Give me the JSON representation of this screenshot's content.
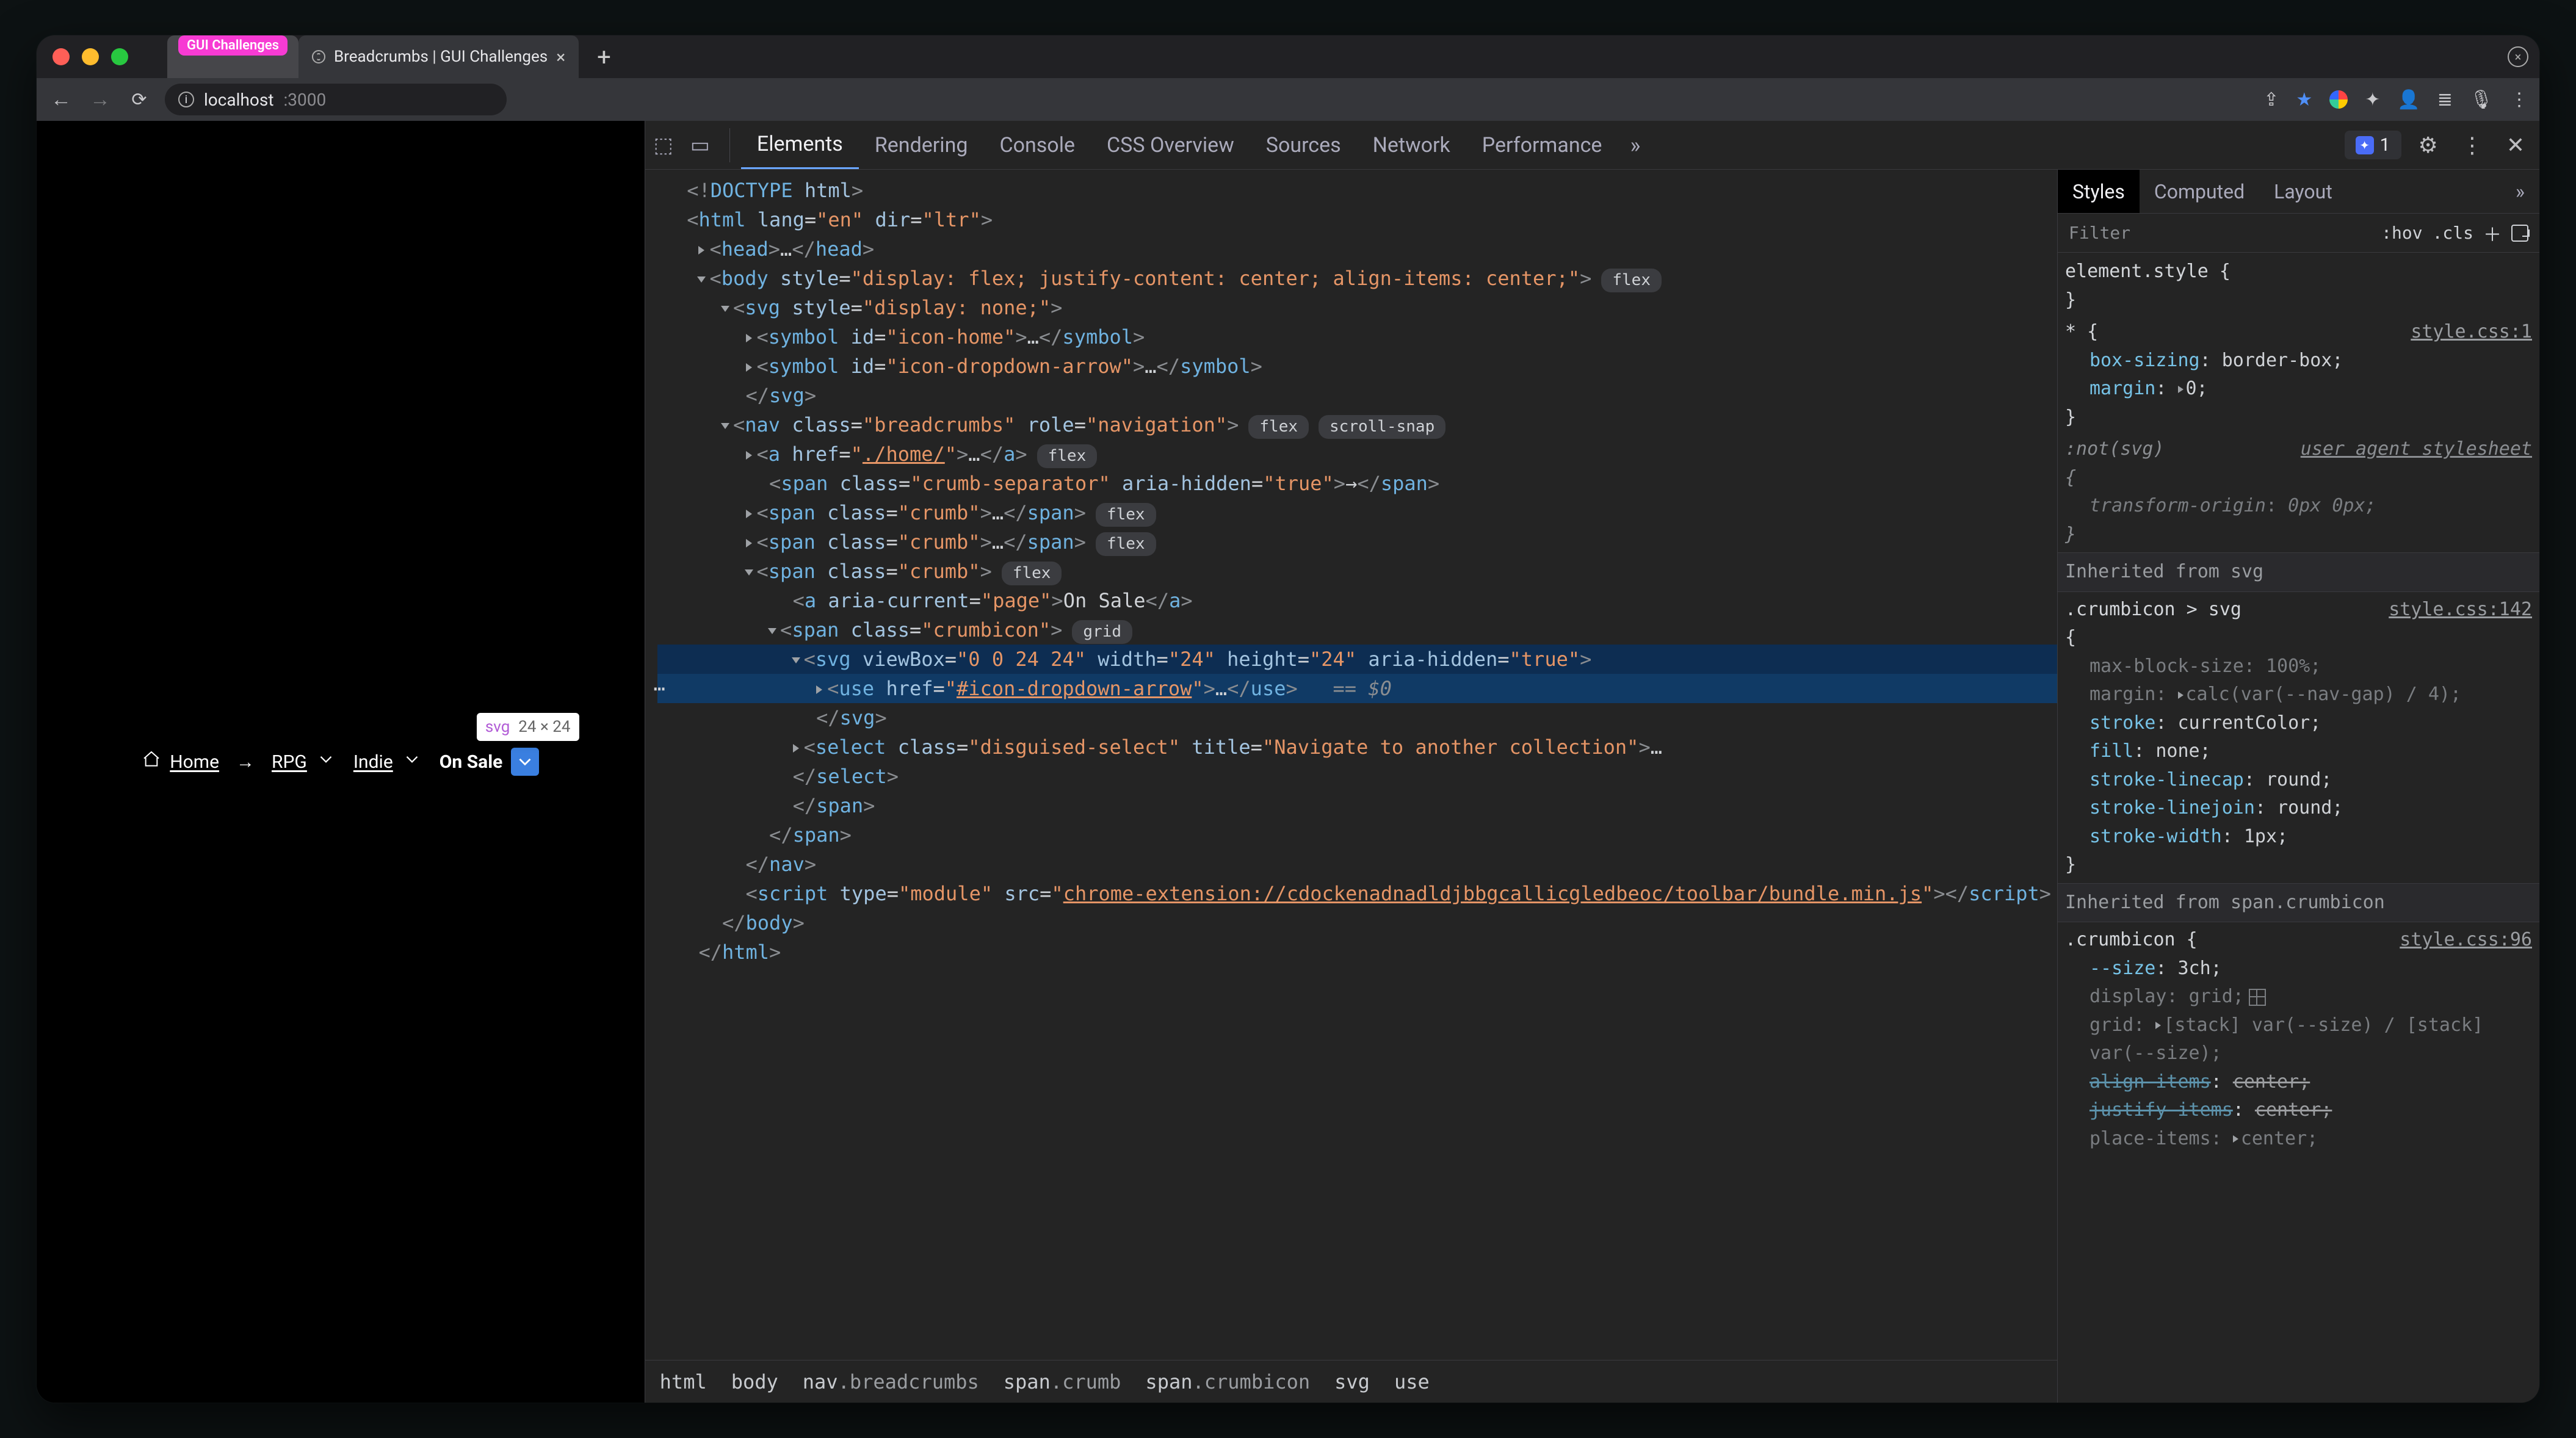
{
  "window": {
    "tabs": [
      {
        "label": "GUI Challenges",
        "kind": "pill"
      },
      {
        "label": "Breadcrumbs | GUI Challenges",
        "kind": "active"
      }
    ]
  },
  "url": {
    "host": "localhost",
    "port": ":3000"
  },
  "page": {
    "tooltip": {
      "tag": "svg",
      "dim": "24 × 24"
    },
    "crumbs": {
      "home": "Home",
      "rpg": "RPG",
      "indie": "Indie",
      "onsale": "On Sale"
    }
  },
  "devtools": {
    "tabs": [
      "Elements",
      "Rendering",
      "Console",
      "CSS Overview",
      "Sources",
      "Network",
      "Performance"
    ],
    "activeTab": "Elements",
    "errorsCount": "1",
    "stylesTabs": [
      "Styles",
      "Computed",
      "Layout"
    ],
    "filterPlaceholder": "Filter",
    "hov": ":hov",
    "cls": ".cls",
    "pathNodes": [
      {
        "el": "html",
        "cls": ""
      },
      {
        "el": "body",
        "cls": ""
      },
      {
        "el": "nav",
        "cls": ".breadcrumbs"
      },
      {
        "el": "span",
        "cls": ".crumb"
      },
      {
        "el": "span",
        "cls": ".crumbicon"
      },
      {
        "el": "svg",
        "cls": ""
      },
      {
        "el": "use",
        "cls": ""
      }
    ],
    "dom": {
      "doctype": "<!DOCTYPE html>",
      "htmlOpen": {
        "attrs": "lang=\"en\" dir=\"ltr\""
      },
      "bodyStyle": "display: flex; justify-content: center; align-items: center;",
      "svgStyle": "display: none;",
      "sym1": "icon-home",
      "sym2": "icon-dropdown-arrow",
      "navClass": "breadcrumbs",
      "navRole": "navigation",
      "aHref": "./home/",
      "sepClass": "crumb-separator",
      "sepAria": "true",
      "crumbClass": "crumb",
      "aCurrent": "page",
      "aText": "On Sale",
      "iconClass": "crumbicon",
      "svgVb": "0 0 24 24",
      "svgW": "24",
      "svgH": "24",
      "svgAria": "true",
      "useHref": "#icon-dropdown-arrow",
      "eqVar": "== $0",
      "selectClass": "disguised-select",
      "selectTitle": "Navigate to another collection",
      "scriptType": "module",
      "scriptSrc": "chrome-extension://cdockenadnadldjbbgcallicgledbeoc/toolbar/bundle.min.js"
    },
    "styles": {
      "r0": {
        "sel": "element.style {"
      },
      "r1": {
        "sel": "* {",
        "src": "style.css:1",
        "p": [
          {
            "k": "box-sizing",
            "v": "border-box;"
          },
          {
            "k": "margin",
            "v": "0;",
            "tri": true
          }
        ]
      },
      "r2": {
        "sel": ":not(svg)",
        "src": "user agent stylesheet",
        "p": [
          {
            "k": "transform-origin",
            "v": "0px 0px;"
          }
        ],
        "italicSrc": true,
        "muted": true
      },
      "inh1": {
        "label": "Inherited from",
        "code": "svg"
      },
      "r3": {
        "sel": ".crumbicon > svg",
        "src": "style.css:142",
        "p": [
          {
            "k": "max-block-size",
            "v": "100%;",
            "muted": true
          },
          {
            "k": "margin",
            "v": "calc(var(--nav-gap) / 4);",
            "tri": true,
            "muted": true
          },
          {
            "k": "stroke",
            "v": "currentColor;"
          },
          {
            "k": "fill",
            "v": "none;"
          },
          {
            "k": "stroke-linecap",
            "v": "round;"
          },
          {
            "k": "stroke-linejoin",
            "v": "round;"
          },
          {
            "k": "stroke-width",
            "v": "1px;"
          }
        ]
      },
      "inh2": {
        "label": "Inherited from",
        "code": "span.crumbicon"
      },
      "r4": {
        "sel": ".crumbicon {",
        "src": "style.css:96",
        "p": [
          {
            "k": "--size",
            "v": "3ch;"
          },
          {
            "k": "display",
            "v": "grid;",
            "muted": true,
            "glyph": true
          },
          {
            "k": "grid",
            "v": "[stack] var(--size) / [stack] var(--size);",
            "tri": true,
            "muted": true,
            "wrap": true
          },
          {
            "k": "align-items",
            "v": "center;",
            "strike": true
          },
          {
            "k": "justify-items",
            "v": "center;",
            "strike": true
          },
          {
            "k": "place-items",
            "v": "center;",
            "tri": true,
            "muted": true
          }
        ]
      }
    }
  }
}
